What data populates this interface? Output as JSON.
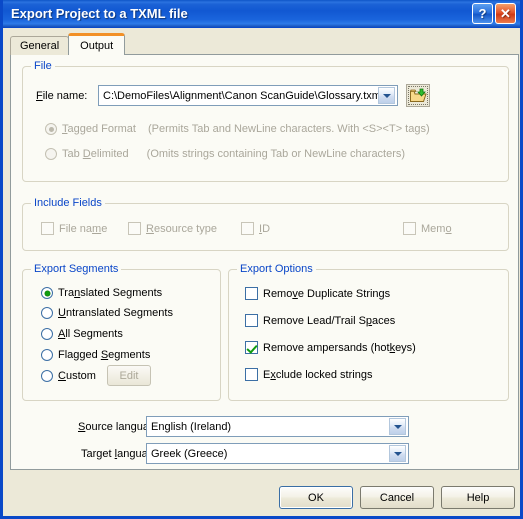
{
  "window": {
    "title": "Export Project to a TXML file",
    "help_button": "?",
    "close_button": "✕",
    "help_icon": "question-mark-icon",
    "close_icon": "close-x-icon"
  },
  "tabs": [
    {
      "label": "General",
      "active": false
    },
    {
      "label": "Output",
      "active": true
    }
  ],
  "file_group": {
    "legend": "File",
    "file_name_label": "File name:",
    "file_name_accel": "F",
    "file_name_value": "C:\\DemoFiles\\Alignment\\Canon ScanGuide\\Glossary.txml",
    "browse_icon": "open-folder-icon",
    "dropdown_icon": "chevron-down-icon"
  },
  "format_options": [
    {
      "label": "Tagged Format",
      "accel": "T",
      "description": "(Permits Tab and NewLine characters. With <S><T> tags)",
      "checked": true,
      "disabled": true
    },
    {
      "label": "Tab Delimited",
      "accel": "D",
      "description": "(Omits strings containing Tab or NewLine characters)",
      "checked": false,
      "disabled": true
    }
  ],
  "include_fields": {
    "legend": "Include Fields",
    "items": [
      {
        "label": "File name",
        "accel": "m",
        "checked": false,
        "disabled": true
      },
      {
        "label": "Resource type",
        "accel": "R",
        "checked": false,
        "disabled": true
      },
      {
        "label": "ID",
        "accel": "I",
        "checked": false,
        "disabled": true
      },
      {
        "label": "Memo",
        "accel": "o",
        "checked": false,
        "disabled": true
      }
    ]
  },
  "export_segments": {
    "legend": "Export Segments",
    "items": [
      {
        "label": "Translated Segments",
        "accel": "n",
        "checked": true
      },
      {
        "label": "Untranslated Segments",
        "accel": "U",
        "checked": false
      },
      {
        "label": "All Segments",
        "accel": "A",
        "checked": false
      },
      {
        "label": "Flagged Segments",
        "accel": "S",
        "checked": false
      },
      {
        "label": "Custom",
        "accel": "C",
        "checked": false
      }
    ],
    "edit_button": "Edit",
    "edit_disabled": true
  },
  "export_options": {
    "legend": "Export Options",
    "items": [
      {
        "label": "Remove Duplicate Strings",
        "accel": "y",
        "checked": false
      },
      {
        "label": "Remove Lead/Trail Spaces",
        "accel": "p",
        "checked": false
      },
      {
        "label": "Remove ampersands (hotkeys)",
        "accel": "k",
        "checked": true
      },
      {
        "label": "Exclude locked strings",
        "accel": "x",
        "checked": false
      }
    ]
  },
  "languages": {
    "source_label": "Source language:",
    "source_accel": "S",
    "source_value": "English (Ireland)",
    "target_label": "Target language:",
    "target_accel": "l",
    "target_value": "Greek (Greece)",
    "dropdown_icon": "chevron-down-icon"
  },
  "footer": {
    "ok": "OK",
    "cancel": "Cancel",
    "help": "Help"
  },
  "colors": {
    "title_blue": "#1158d2",
    "dialog_face": "#ece9d8",
    "tabpage": "#fbfbf5",
    "group_label": "#0a46c8",
    "active_tab_accent": "#f29026",
    "check_green": "#109c10",
    "disabled_text": "#aaa79b"
  }
}
